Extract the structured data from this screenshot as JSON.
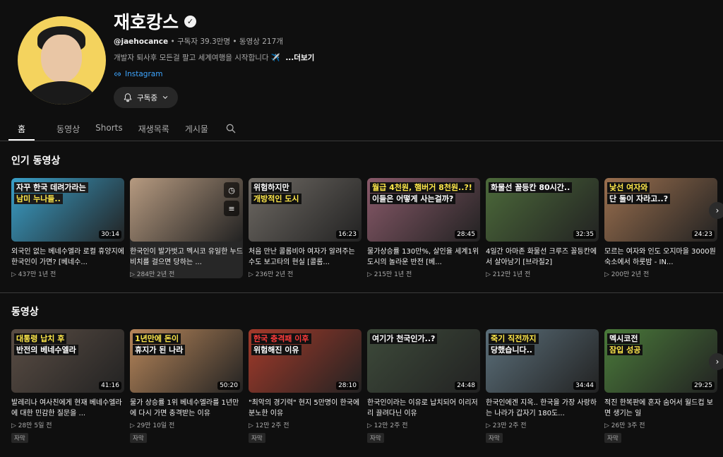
{
  "channel": {
    "name": "재호캉스",
    "handle": "@jaehocance",
    "subscribers": "구독자 39.3만명",
    "video_count": "동영상 217개",
    "description": "개발자 퇴사후 모든걸 팔고 세계여행을 시작합니다 ✈️",
    "more": "...더보기",
    "link": "Instagram",
    "subscribe_label": "구독중"
  },
  "tabs": [
    "홈",
    "동영상",
    "Shorts",
    "재생목록",
    "게시물"
  ],
  "sections": {
    "popular": "인기 동영상",
    "videos": "동영상"
  },
  "popular_videos": [
    {
      "cap1": "자꾸 한국 데려가라는",
      "cap2": "남미 누나들..",
      "duration": "30:14",
      "title": "외국인 없는 베네수엘라 로컬 휴양지에 한국인이 가면? [베네수...",
      "meta": "▷ 437만  1년 전",
      "bg": "#3aa0c9",
      "c1bg": "#1b1b1b",
      "c1fg": "#ffffff",
      "c2bg": "#1b1b1b",
      "c2fg": "#ffe84a"
    },
    {
      "cap1": "",
      "cap2": "",
      "duration": "",
      "title": "한국인이 발가벗고 멕시코 유일한 누드비치를 걸으면 당하는 ...",
      "meta": "▷ 284만  2년 전",
      "bg": "#b69a80",
      "c1bg": "transparent",
      "c1fg": "#fff",
      "c2bg": "transparent",
      "c2fg": "#fff"
    },
    {
      "cap1": "위험하지만",
      "cap2": "개방적인 도시",
      "duration": "16:23",
      "title": "처음 만난 콜롬비아 여자가 알려주는 수도 보고타의 현실 [콜롬...",
      "meta": "▷ 236만  2년 전",
      "bg": "#6f6a64",
      "c1bg": "#111",
      "c1fg": "#ffffff",
      "c2bg": "#111",
      "c2fg": "#ffe84a"
    },
    {
      "cap1": "월급 4천원, 햄버거 8천원..?!",
      "cap2": "이들은 어떻게 사는걸까?",
      "duration": "28:45",
      "title": "물가상승률 130만%, 살인율 세계1위 도시의 놀라운 반전 [베...",
      "meta": "▷ 215만  1년 전",
      "bg": "#8a5a6a",
      "c1bg": "#111",
      "c1fg": "#ffe84a",
      "c2bg": "#111",
      "c2fg": "#ffffff"
    },
    {
      "cap1": "화물선 꼴등칸 80시간..",
      "cap2": "",
      "duration": "32:35",
      "title": "4일간 아마존 화물선 크루즈 꼴등칸에서 살아남기 [브라질2]",
      "meta": "▷ 212만  1년 전",
      "bg": "#4c6a3a",
      "c1bg": "#111",
      "c1fg": "#ffffff",
      "c2bg": "transparent",
      "c2fg": "#fff"
    },
    {
      "cap1": "낯선 여자와",
      "cap2": "단 둘이 자라고..?",
      "duration": "24:23",
      "title": "모르는 여자와 인도 오지마을 3000원 숙소에서 하룻밤 - IN...",
      "meta": "▷ 200만  2년 전",
      "bg": "#9a6f4e",
      "c1bg": "#111",
      "c1fg": "#ffe84a",
      "c2bg": "#111",
      "c2fg": "#ffffff"
    }
  ],
  "videos": [
    {
      "cap1": "대통령 납치 후",
      "cap2": "반전의 베네수엘라",
      "duration": "41:16",
      "title": "발레리나 여사친에게 현재 베네수엘라에 대한 민감한 질문을 ...",
      "meta": "▷ 28만  5일 전",
      "badge": "자막",
      "bg": "#5a4d44",
      "c1bg": "#111",
      "c1fg": "#ffe84a",
      "c2bg": "#111",
      "c2fg": "#ffffff"
    },
    {
      "cap1": "1년만에 돈이",
      "cap2": "휴지가 된 나라",
      "duration": "50:20",
      "title": "물가 상승률 1위 베네수엘라를 1년만에 다시 가면 충격받는 이유",
      "meta": "▷ 29만  10일 전",
      "badge": "자막",
      "bg": "#b7865a",
      "c1bg": "#111",
      "c1fg": "#ffe84a",
      "c2bg": "#111",
      "c2fg": "#ffffff"
    },
    {
      "cap1": "한국 충격패 이후",
      "cap2": "위험해진 이유",
      "duration": "28:10",
      "title": "\"최악의 경기력\" 현지 5만명이 한국에 분노한 이유",
      "meta": "▷ 12만  2주 전",
      "badge": "자막",
      "bg": "#a43a2a",
      "c1bg": "#111",
      "c1fg": "#ff3b3b",
      "c2bg": "#111",
      "c2fg": "#ffffff"
    },
    {
      "cap1": "여기가 천국인가..?",
      "cap2": "",
      "duration": "24:48",
      "title": "한국인이라는 이유로 납치되어 이리저리 끌려다닌 이유",
      "meta": "▷ 12만  2주 전",
      "badge": "자막",
      "bg": "#3d4a3a",
      "c1bg": "#111",
      "c1fg": "#ffffff",
      "c2bg": "transparent",
      "c2fg": "#fff"
    },
    {
      "cap1": "죽기 직전까지",
      "cap2": "당했습니다..",
      "duration": "34:44",
      "title": "한국인에겐 지옥.. 한국을 가장 사랑하는 나라가 갑자기 180도...",
      "meta": "▷ 23만  2주 전",
      "badge": "자막",
      "bg": "#5b6f7a",
      "c1bg": "#111",
      "c1fg": "#ffe84a",
      "c2bg": "#111",
      "c2fg": "#ffffff"
    },
    {
      "cap1": "멕시코전",
      "cap2": "잠입 성공",
      "duration": "29:25",
      "title": "적진 한복판에 혼자 숨어서 월드컵 보면 생기는 일",
      "meta": "▷ 26만  3주 전",
      "badge": "자막",
      "bg": "#4a7a3a",
      "c1bg": "#111",
      "c1fg": "#ffffff",
      "c2bg": "#111",
      "c2fg": "#ffe84a"
    }
  ]
}
